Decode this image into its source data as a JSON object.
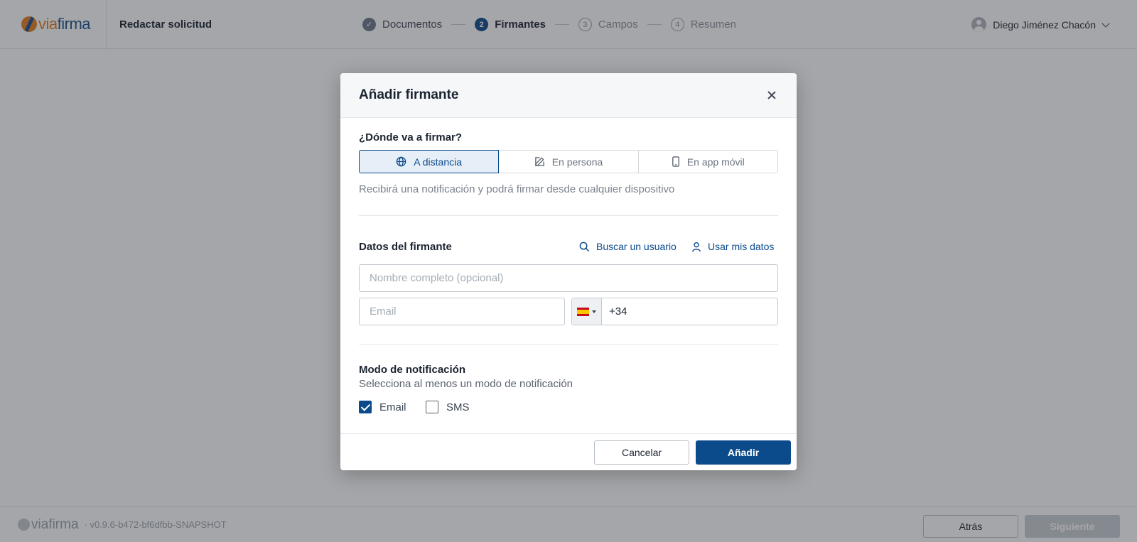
{
  "header": {
    "logo": {
      "via": "via",
      "firma": "firma"
    },
    "page_title": "Redactar solicitud",
    "steps": [
      {
        "num": "✓",
        "label": "Documentos",
        "state": "done"
      },
      {
        "num": "2",
        "label": "Firmantes",
        "state": "active"
      },
      {
        "num": "3",
        "label": "Campos",
        "state": "pending"
      },
      {
        "num": "4",
        "label": "Resumen",
        "state": "pending"
      }
    ],
    "user_name": "Diego Jiménez Chacón"
  },
  "footer": {
    "logo": "viafirma",
    "version": "· v0.9.6-b472-bf6dfbb-SNAPSHOT",
    "back_label": "Atrás",
    "next_label": "Siguiente"
  },
  "modal": {
    "title": "Añadir firmante",
    "where_label": "¿Dónde va a firmar?",
    "modes": [
      {
        "label": "A distancia",
        "icon": "globe-icon",
        "selected": true
      },
      {
        "label": "En persona",
        "icon": "pencil-icon",
        "selected": false
      },
      {
        "label": "En app móvil",
        "icon": "mobile-icon",
        "selected": false
      }
    ],
    "hint": "Recibirá una notificación y podrá firmar desde cualquier dispositivo",
    "signer_label": "Datos del firmante",
    "search_user_label": "Buscar un usuario",
    "use_my_data_label": "Usar mis datos",
    "name_placeholder": "Nombre completo (opcional)",
    "name_value": "",
    "email_placeholder": "Email",
    "email_value": "",
    "phone_country": "ES",
    "phone_value": "+34",
    "notif_label": "Modo de notificación",
    "notif_sub": "Selecciona al menos un modo de notificación",
    "notif_options": [
      {
        "label": "Email",
        "checked": true
      },
      {
        "label": "SMS",
        "checked": false
      }
    ],
    "cancel_label": "Cancelar",
    "add_label": "Añadir"
  },
  "colors": {
    "primary": "#0b4a8b",
    "accent": "#e37d1c"
  }
}
